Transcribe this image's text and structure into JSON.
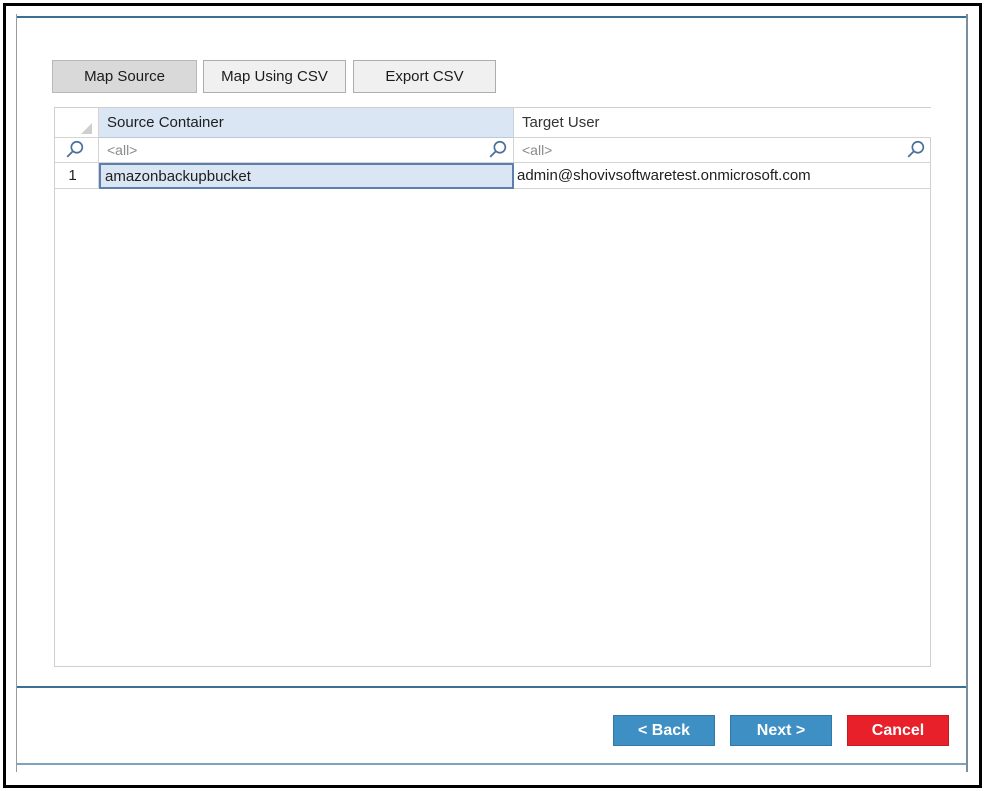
{
  "toolbar": {
    "map_source": "Map Source",
    "map_using_csv": "Map Using CSV",
    "export_csv": "Export CSV"
  },
  "grid": {
    "columns": [
      "Source Container",
      "Target User"
    ],
    "filter_placeholders": [
      "<all>",
      "<all>"
    ],
    "rows": [
      {
        "num": "1",
        "source": "amazonbackupbucket",
        "target": "admin@shovivsoftwaretest.onmicrosoft.com"
      }
    ]
  },
  "footer": {
    "back": "< Back",
    "next": "Next >",
    "cancel": "Cancel"
  },
  "colors": {
    "accent": "#3a7193",
    "nav_button": "#3d8fc4",
    "cancel_button": "#e8202a",
    "selected_cell": "#dae6f4"
  },
  "icons": [
    "search-icon",
    "corner-triangle-icon"
  ]
}
